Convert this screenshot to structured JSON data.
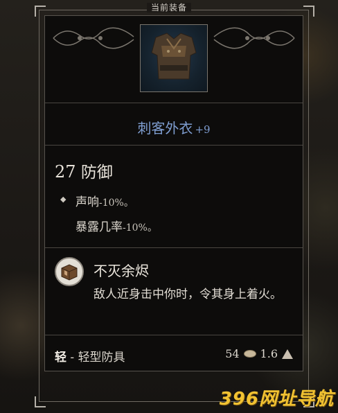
{
  "header": {
    "title": "当前装备"
  },
  "item": {
    "name": "刺客外衣",
    "enchant": "+9",
    "image_icon": "armor-vest-icon"
  },
  "stats": {
    "armor_value": "27",
    "armor_label": "防御",
    "modifiers": [
      {
        "name": "声响",
        "value": "-10%。"
      },
      {
        "name": "暴露几率",
        "value": "-10%。"
      }
    ]
  },
  "passive": {
    "icon": "fire-crate-icon",
    "title": "不灭余烬",
    "description": "敌人近身击中你时，令其身上着火。"
  },
  "footer": {
    "weight_class": "轻",
    "separator": " - ",
    "type": "轻型防具",
    "price": "54",
    "weight": "1.6"
  },
  "watermark": "396网址导航",
  "colors": {
    "item_name": "#7f9ed1",
    "watermark": "#f1c232"
  }
}
